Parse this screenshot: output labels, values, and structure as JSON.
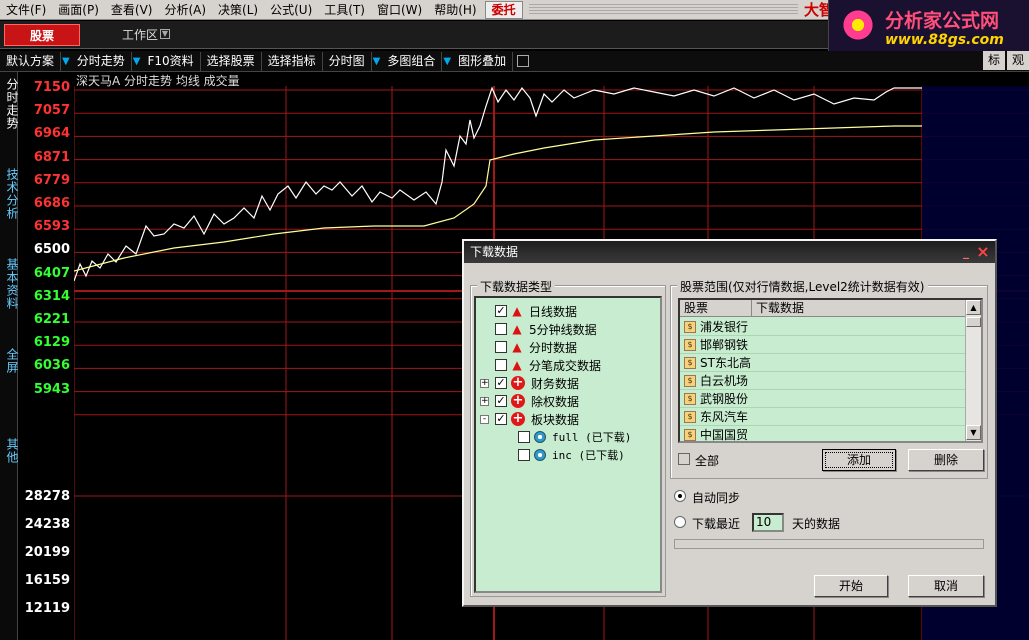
{
  "menu": {
    "items": [
      "文件(F)",
      "画面(P)",
      "查看(V)",
      "分析(A)",
      "决策(L)",
      "公式(U)",
      "工具(T)",
      "窗口(W)",
      "帮助(H)"
    ],
    "entrust": "委托",
    "brand": "大智慧"
  },
  "promo": {
    "title": "分析家公式网",
    "url": "www.88gs.com"
  },
  "tabs": {
    "stock": "股票",
    "workspace": "工作区"
  },
  "toolbar": {
    "items": [
      "默认方案",
      "分时走势",
      "F10资料",
      "选择股票",
      "选择指标",
      "分时图",
      "多图组合",
      "图形叠加"
    ],
    "right_buttons": [
      "标",
      "观"
    ]
  },
  "side_tabs": [
    "分时走势",
    "技术分析",
    "基本资料",
    "全屏",
    "其他"
  ],
  "chart": {
    "caption": "深天马A 分时走势 均线 成交量",
    "price_labels": [
      {
        "text": "7150",
        "color": "#ff3333"
      },
      {
        "text": "7057",
        "color": "#ff3333"
      },
      {
        "text": "6964",
        "color": "#ff3333"
      },
      {
        "text": "6871",
        "color": "#ff3333"
      },
      {
        "text": "6779",
        "color": "#ff3333"
      },
      {
        "text": "6686",
        "color": "#ff3333"
      },
      {
        "text": "6593",
        "color": "#ff3333"
      },
      {
        "text": "6500",
        "color": "#ffffff"
      },
      {
        "text": "6407",
        "color": "#33ff33"
      },
      {
        "text": "6314",
        "color": "#33ff33"
      },
      {
        "text": "6221",
        "color": "#33ff33"
      },
      {
        "text": "6129",
        "color": "#33ff33"
      },
      {
        "text": "6036",
        "color": "#33ff33"
      },
      {
        "text": "5943",
        "color": "#33ff33"
      }
    ],
    "volume_labels": [
      "28278",
      "24238",
      "20199",
      "16159",
      "12119"
    ],
    "grid_color": "#a01818",
    "price_line_color": "#ffffff",
    "avg_line_color": "#ffff99"
  },
  "dialog": {
    "title": "下载数据",
    "type_group": "下载数据类型",
    "tree": [
      {
        "label": "日线数据",
        "checked": true,
        "icon": "arrow-up-icon",
        "expander": "",
        "indent": 0
      },
      {
        "label": "5分钟线数据",
        "checked": false,
        "icon": "arrow-up-icon",
        "expander": "",
        "indent": 0
      },
      {
        "label": "分时数据",
        "checked": false,
        "icon": "arrow-up-icon",
        "expander": "",
        "indent": 0
      },
      {
        "label": "分笔成交数据",
        "checked": false,
        "icon": "arrow-up-icon",
        "expander": "",
        "indent": 0
      },
      {
        "label": "财务数据",
        "checked": true,
        "icon": "red-plus-icon",
        "expander": "+",
        "indent": 0
      },
      {
        "label": "除权数据",
        "checked": true,
        "icon": "red-plus-icon",
        "expander": "+",
        "indent": 0
      },
      {
        "label": "板块数据",
        "checked": true,
        "icon": "red-plus-icon",
        "expander": "-",
        "indent": 0
      },
      {
        "label": "full (已下载)",
        "checked": false,
        "icon": "globe-icon",
        "expander": "",
        "indent": 1
      },
      {
        "label": "inc (已下载)",
        "checked": false,
        "icon": "globe-icon",
        "expander": "",
        "indent": 1
      }
    ],
    "range_group": "股票范围(仅对行情数据,Level2统计数据有效)",
    "list_headers": [
      "股票",
      "下载数据"
    ],
    "stocks": [
      "浦发银行",
      "邯郸钢铁",
      "ST东北高",
      "白云机场",
      "武钢股份",
      "东风汽车",
      "中国国贸"
    ],
    "all_label": "全部",
    "add_button": "添加",
    "delete_button": "删除",
    "auto_sync": "自动同步",
    "recent_prefix": "下载最近",
    "days_value": "10",
    "recent_suffix": "天的数据",
    "start_button": "开始",
    "cancel_button": "取消"
  }
}
